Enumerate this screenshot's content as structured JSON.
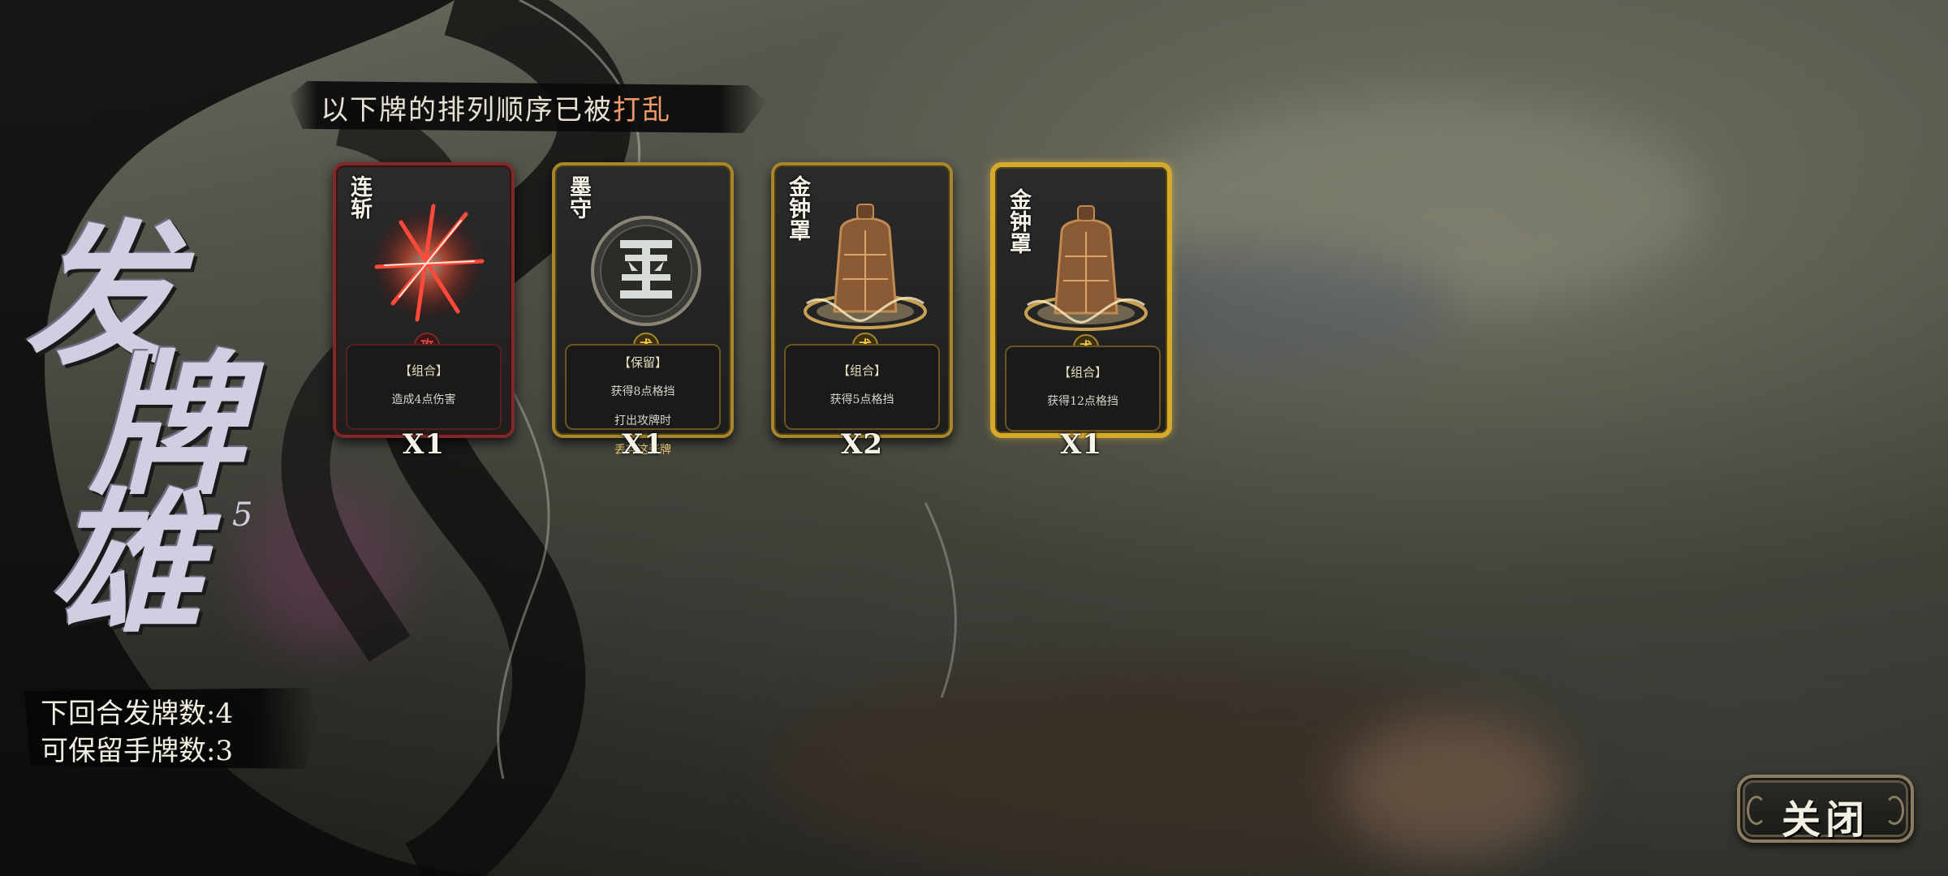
{
  "banner": {
    "prefix": "以下牌的排列顺序已被",
    "highlight": "打乱",
    "highlight_color": "#ef9a6a"
  },
  "title": {
    "chars": [
      "发",
      "牌",
      "雄"
    ],
    "number": "5"
  },
  "info": {
    "next_round_deal": "下回合发牌数:4",
    "keep_hand": "可保留手牌数:3"
  },
  "cards": [
    {
      "name": "连斩",
      "border": "red",
      "art_icon": "slash-burst-icon",
      "seal": "攻",
      "type": "【组合】",
      "desc_lines": [
        "造成4点伤害"
      ],
      "count": "X1"
    },
    {
      "name": "墨守",
      "border": "gold",
      "art_icon": "ink-seal-icon",
      "seal": "术",
      "type": "【保留】",
      "desc_lines": [
        "获得8点格挡",
        "打出攻牌时",
        "丢弃这张牌"
      ],
      "count": "X1"
    },
    {
      "name": "金钟罩",
      "border": "gold",
      "art_icon": "golden-bell-icon",
      "seal": "术",
      "type": "【组合】",
      "desc_lines": [
        "获得5点格挡"
      ],
      "count": "X2"
    },
    {
      "name": "金钟罩",
      "border": "brightgold",
      "art_icon": "golden-bell-icon",
      "seal": "术",
      "type": "【组合】",
      "desc_lines": [
        "获得12点格挡"
      ],
      "count": "X1"
    }
  ],
  "close_button": {
    "label": "关闭"
  }
}
